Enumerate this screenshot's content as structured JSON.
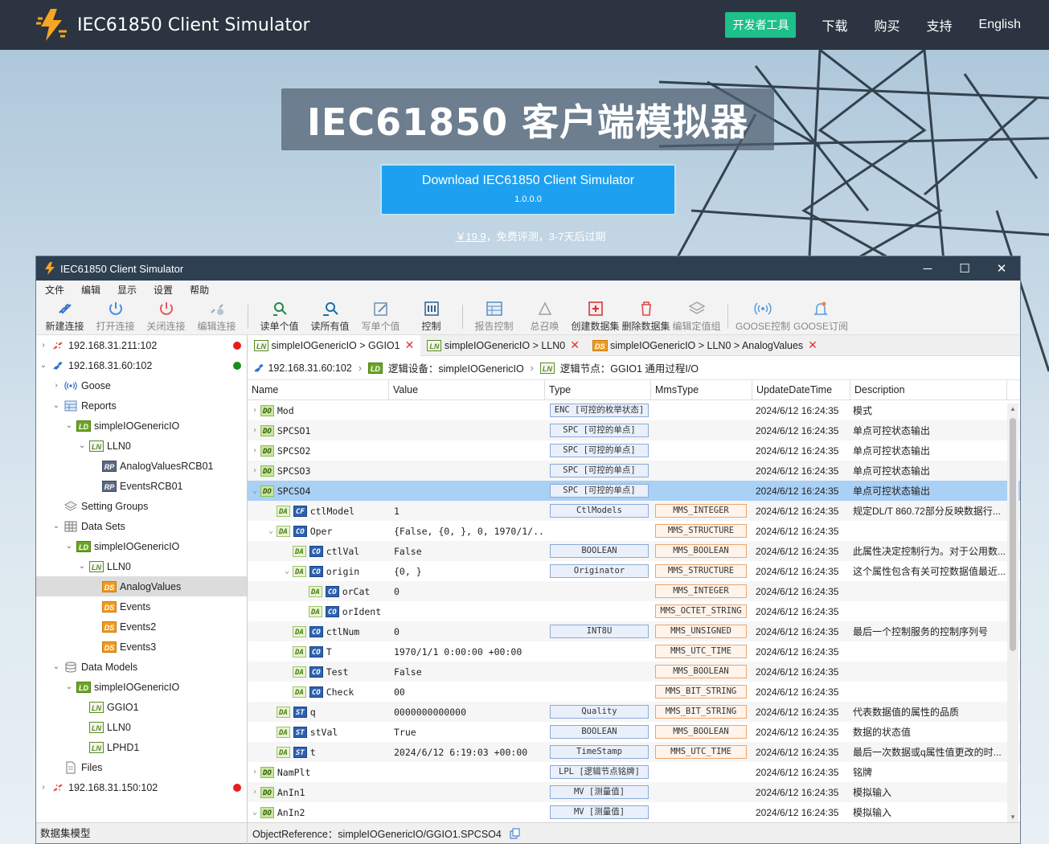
{
  "site": {
    "title": "IEC61850 Client Simulator",
    "nav": {
      "dev_tools": "开发者工具",
      "download": "下载",
      "buy": "购买",
      "support": "支持",
      "language": "English"
    },
    "hero_title": "IEC61850 客户端模拟器",
    "download_button": {
      "label": "Download IEC61850 Client Simulator",
      "version": "1.0.0.0"
    },
    "price": "￥19.9",
    "price_note": "，免费评测，3-7天后过期"
  },
  "window": {
    "title": "IEC61850 Client Simulator",
    "controls": {
      "minimize": "─",
      "maximize": "☐",
      "close": "✕"
    },
    "menu": [
      "文件",
      "编辑",
      "显示",
      "设置",
      "帮助"
    ],
    "toolbar": {
      "new_conn": "新建连接",
      "open_conn": "打开连接",
      "close_conn": "关闭连接",
      "edit_conn": "编辑连接",
      "read_single": "读单个值",
      "read_all": "读所有值",
      "write_single": "写单个值",
      "control": "控制",
      "report_ctrl": "报告控制",
      "gi": "总召唤",
      "create_ds": "创建数据集",
      "delete_ds": "删除数据集",
      "edit_sg": "编辑定值组",
      "goose_ctrl": "GOOSE控制",
      "goose_sub": "GOOSE订阅"
    }
  },
  "tree": [
    {
      "label": "192.168.31.211:102",
      "depth": 0,
      "caret": "›",
      "icon": "conn-broken",
      "status": "#e81c1c"
    },
    {
      "label": "192.168.31.60:102",
      "depth": 0,
      "caret": "⌄",
      "icon": "conn",
      "status": "#1a8f1a"
    },
    {
      "label": "Goose",
      "depth": 1,
      "caret": "›",
      "icon": "goose"
    },
    {
      "label": "Reports",
      "depth": 1,
      "caret": "⌄",
      "icon": "reports"
    },
    {
      "label": "simpleIOGenericIO",
      "depth": 2,
      "caret": "⌄",
      "badge": "LD"
    },
    {
      "label": "LLN0",
      "depth": 3,
      "caret": "⌄",
      "badge": "LN"
    },
    {
      "label": "AnalogValuesRCB01",
      "depth": 4,
      "caret": "",
      "badge": "RP"
    },
    {
      "label": "EventsRCB01",
      "depth": 4,
      "caret": "",
      "badge": "RP"
    },
    {
      "label": "Setting Groups",
      "depth": 1,
      "caret": "",
      "icon": "settings"
    },
    {
      "label": "Data Sets",
      "depth": 1,
      "caret": "⌄",
      "icon": "datasets"
    },
    {
      "label": "simpleIOGenericIO",
      "depth": 2,
      "caret": "⌄",
      "badge": "LD"
    },
    {
      "label": "LLN0",
      "depth": 3,
      "caret": "⌄",
      "badge": "LN"
    },
    {
      "label": "AnalogValues",
      "depth": 4,
      "caret": "",
      "badge": "DS",
      "selected": true
    },
    {
      "label": "Events",
      "depth": 4,
      "caret": "",
      "badge": "DS"
    },
    {
      "label": "Events2",
      "depth": 4,
      "caret": "",
      "badge": "DS"
    },
    {
      "label": "Events3",
      "depth": 4,
      "caret": "",
      "badge": "DS"
    },
    {
      "label": "Data Models",
      "depth": 1,
      "caret": "⌄",
      "icon": "models"
    },
    {
      "label": "simpleIOGenericIO",
      "depth": 2,
      "caret": "⌄",
      "badge": "LD"
    },
    {
      "label": "GGIO1",
      "depth": 3,
      "caret": "",
      "badge": "LN"
    },
    {
      "label": "LLN0",
      "depth": 3,
      "caret": "",
      "badge": "LN"
    },
    {
      "label": "LPHD1",
      "depth": 3,
      "caret": "",
      "badge": "LN"
    },
    {
      "label": "Files",
      "depth": 1,
      "caret": "",
      "icon": "files"
    },
    {
      "label": "192.168.31.150:102",
      "depth": 0,
      "caret": "›",
      "icon": "conn-broken",
      "status": "#e81c1c"
    }
  ],
  "tabs": [
    {
      "badge": "LN",
      "label": "simpleIOGenericIO > GGIO1",
      "close": "✕"
    },
    {
      "badge": "LN",
      "label": "simpleIOGenericIO > LLN0",
      "close": "✕"
    },
    {
      "badge": "DS",
      "label": "simpleIOGenericIO > LLN0 > AnalogValues",
      "close": "✕"
    }
  ],
  "breadcrumb": {
    "conn": "192.168.31.60:102",
    "ld_badge": "LD",
    "ld": "逻辑设备：simpleIOGenericIO",
    "ln_badge": "LN",
    "ln": "逻辑节点：GGIO1 通用过程I/O"
  },
  "columns": [
    "Name",
    "Value",
    "Type",
    "MmsType",
    "UpdateDateTime",
    "Description"
  ],
  "rows": [
    {
      "depth": 0,
      "caret": "›",
      "badges": [
        "DO"
      ],
      "name": "Mod",
      "value": "",
      "type": "ENC [可控的枚举状态]",
      "mms": "",
      "time": "2024/6/12 16:24:35",
      "desc": "模式"
    },
    {
      "depth": 0,
      "caret": "›",
      "badges": [
        "DO"
      ],
      "name": "SPCSO1",
      "value": "",
      "type": "SPC [可控的单点]",
      "mms": "",
      "time": "2024/6/12 16:24:35",
      "desc": "单点可控状态输出"
    },
    {
      "depth": 0,
      "caret": "›",
      "badges": [
        "DO"
      ],
      "name": "SPCSO2",
      "value": "",
      "type": "SPC [可控的单点]",
      "mms": "",
      "time": "2024/6/12 16:24:35",
      "desc": "单点可控状态输出"
    },
    {
      "depth": 0,
      "caret": "›",
      "badges": [
        "DO"
      ],
      "name": "SPCSO3",
      "value": "",
      "type": "SPC [可控的单点]",
      "mms": "",
      "time": "2024/6/12 16:24:35",
      "desc": "单点可控状态输出"
    },
    {
      "depth": 0,
      "caret": "⌄",
      "badges": [
        "DO"
      ],
      "name": "SPCSO4",
      "value": "",
      "type": "SPC [可控的单点]",
      "mms": "",
      "time": "2024/6/12 16:24:35",
      "desc": "单点可控状态输出",
      "selected": true
    },
    {
      "depth": 1,
      "caret": "",
      "badges": [
        "DA",
        "CF"
      ],
      "name": "ctlModel",
      "value": "1",
      "type": "CtlModels",
      "mms": "MMS_INTEGER",
      "time": "2024/6/12 16:24:35",
      "desc": "规定DL/T 860.72部分反映数据行..."
    },
    {
      "depth": 1,
      "caret": "⌄",
      "badges": [
        "DA",
        "CO"
      ],
      "name": "Oper",
      "value": "{False, {0, }, 0, 1970/1/...",
      "type": "",
      "mms": "MMS_STRUCTURE",
      "time": "2024/6/12 16:24:35",
      "desc": ""
    },
    {
      "depth": 2,
      "caret": "",
      "badges": [
        "DA",
        "CO"
      ],
      "name": "ctlVal",
      "value": "False",
      "type": "BOOLEAN",
      "mms": "MMS_BOOLEAN",
      "time": "2024/6/12 16:24:35",
      "desc": "此属性决定控制行为。对于公用数..."
    },
    {
      "depth": 2,
      "caret": "⌄",
      "badges": [
        "DA",
        "CO"
      ],
      "name": "origin",
      "value": "{0, }",
      "type": "Originator",
      "mms": "MMS_STRUCTURE",
      "time": "2024/6/12 16:24:35",
      "desc": "这个属性包含有关可控数据值最近..."
    },
    {
      "depth": 3,
      "caret": "",
      "badges": [
        "DA",
        "CO"
      ],
      "name": "orCat",
      "value": "0",
      "type": "",
      "mms": "MMS_INTEGER",
      "time": "2024/6/12 16:24:35",
      "desc": ""
    },
    {
      "depth": 3,
      "caret": "",
      "badges": [
        "DA",
        "CO"
      ],
      "name": "orIdent",
      "value": "",
      "type": "",
      "mms": "MMS_OCTET_STRING",
      "time": "2024/6/12 16:24:35",
      "desc": ""
    },
    {
      "depth": 2,
      "caret": "",
      "badges": [
        "DA",
        "CO"
      ],
      "name": "ctlNum",
      "value": "0",
      "type": "INT8U",
      "mms": "MMS_UNSIGNED",
      "time": "2024/6/12 16:24:35",
      "desc": "最后一个控制服务的控制序列号"
    },
    {
      "depth": 2,
      "caret": "",
      "badges": [
        "DA",
        "CO"
      ],
      "name": "T",
      "value": "1970/1/1 0:00:00 +00:00",
      "type": "",
      "mms": "MMS_UTC_TIME",
      "time": "2024/6/12 16:24:35",
      "desc": ""
    },
    {
      "depth": 2,
      "caret": "",
      "badges": [
        "DA",
        "CO"
      ],
      "name": "Test",
      "value": "False",
      "type": "",
      "mms": "MMS_BOOLEAN",
      "time": "2024/6/12 16:24:35",
      "desc": ""
    },
    {
      "depth": 2,
      "caret": "",
      "badges": [
        "DA",
        "CO"
      ],
      "name": "Check",
      "value": "00",
      "type": "",
      "mms": "MMS_BIT_STRING",
      "time": "2024/6/12 16:24:35",
      "desc": ""
    },
    {
      "depth": 1,
      "caret": "",
      "badges": [
        "DA",
        "ST"
      ],
      "name": "q",
      "value": "0000000000000",
      "type": "Quality",
      "mms": "MMS_BIT_STRING",
      "time": "2024/6/12 16:24:35",
      "desc": "代表数据值的属性的品质"
    },
    {
      "depth": 1,
      "caret": "",
      "badges": [
        "DA",
        "ST"
      ],
      "name": "stVal",
      "value": "True",
      "type": "BOOLEAN",
      "mms": "MMS_BOOLEAN",
      "time": "2024/6/12 16:24:35",
      "desc": "数据的状态值"
    },
    {
      "depth": 1,
      "caret": "",
      "badges": [
        "DA",
        "ST"
      ],
      "name": "t",
      "value": "2024/6/12 6:19:03 +00:00",
      "type": "TimeStamp",
      "mms": "MMS_UTC_TIME",
      "time": "2024/6/12 16:24:35",
      "desc": "最后一次数据或q属性值更改的时..."
    },
    {
      "depth": 0,
      "caret": "›",
      "badges": [
        "DO"
      ],
      "name": "NamPlt",
      "value": "",
      "type": "LPL [逻辑节点铭牌]",
      "mms": "",
      "time": "2024/6/12 16:24:35",
      "desc": "铭牌"
    },
    {
      "depth": 0,
      "caret": "›",
      "badges": [
        "DO"
      ],
      "name": "AnIn1",
      "value": "",
      "type": "MV [测量值]",
      "mms": "",
      "time": "2024/6/12 16:24:35",
      "desc": "模拟输入"
    },
    {
      "depth": 0,
      "caret": "⌄",
      "badges": [
        "DO"
      ],
      "name": "AnIn2",
      "value": "",
      "type": "MV [测量值]",
      "mms": "",
      "time": "2024/6/12 16:24:35",
      "desc": "模拟输入"
    }
  ],
  "status": {
    "left": "数据集模型",
    "object_reference": "ObjectReference：simpleIOGenericIO/GGIO1.SPCSO4"
  }
}
